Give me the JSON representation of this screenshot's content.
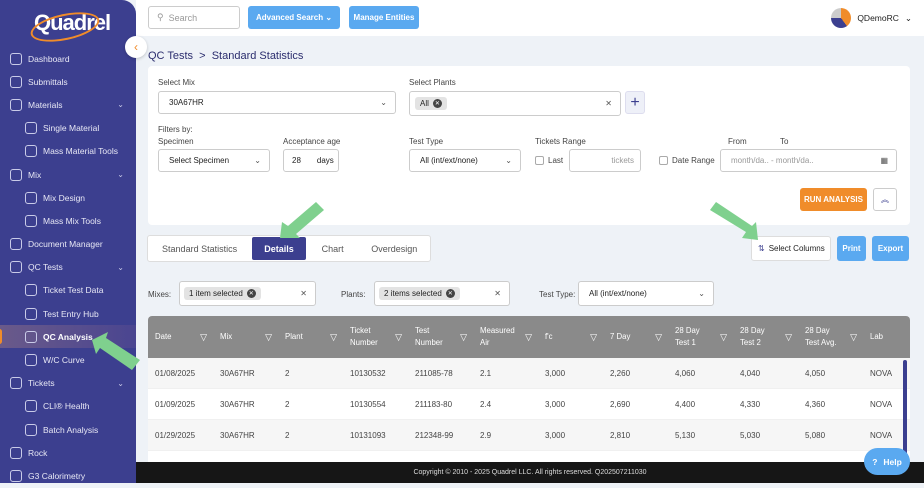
{
  "brand": "Quadrel",
  "sidebar": {
    "items": [
      {
        "label": "Dashboard",
        "sub": false
      },
      {
        "label": "Submittals",
        "sub": false
      },
      {
        "label": "Materials",
        "sub": false,
        "chev": true
      },
      {
        "label": "Single Material",
        "sub": true
      },
      {
        "label": "Mass Material Tools",
        "sub": true
      },
      {
        "label": "Mix",
        "sub": false,
        "chev": true
      },
      {
        "label": "Mix Design",
        "sub": true
      },
      {
        "label": "Mass Mix Tools",
        "sub": true
      },
      {
        "label": "Document Manager",
        "sub": false
      },
      {
        "label": "QC Tests",
        "sub": false,
        "chev": true
      },
      {
        "label": "Ticket Test Data",
        "sub": true
      },
      {
        "label": "Test Entry Hub",
        "sub": true
      },
      {
        "label": "QC Analysis",
        "sub": true,
        "active": true
      },
      {
        "label": "W/C Curve",
        "sub": true
      },
      {
        "label": "Tickets",
        "sub": false,
        "chev": true
      },
      {
        "label": "CLI® Health",
        "sub": true
      },
      {
        "label": "Batch Analysis",
        "sub": true
      },
      {
        "label": "Rock",
        "sub": false
      },
      {
        "label": "G3 Calorimetry",
        "sub": false
      }
    ]
  },
  "topbar": {
    "search_placeholder": "Search",
    "advanced_search": "Advanced Search",
    "manage_entities": "Manage Entities",
    "user": "QDemoRC"
  },
  "breadcrumb": {
    "parent": "QC Tests",
    "sep": ">",
    "current": "Standard Statistics"
  },
  "filters": {
    "select_mix_label": "Select Mix",
    "mix_value": "30A67HR",
    "select_plants_label": "Select Plants",
    "plants_chip": "All",
    "filters_by": "Filters by:",
    "specimen_label": "Specimen",
    "specimen_value": "Select Specimen",
    "acceptance_age_label": "Acceptance age",
    "acceptance_age": "28",
    "days": "days",
    "test_type_label": "Test Type",
    "test_type_value": "All (int/ext/none)",
    "tickets_range_label": "Tickets Range",
    "last_label": "Last",
    "tickets_placeholder": "tickets",
    "date_range_label": "Date Range",
    "from_label": "From",
    "to_label": "To",
    "from_placeholder": "month/da..",
    "to_placeholder": "month/da..",
    "run_analysis": "RUN ANALYSIS"
  },
  "tabs": [
    "Standard Statistics",
    "Details",
    "Chart",
    "Overdesign"
  ],
  "actions": {
    "select_columns": "Select Columns",
    "print": "Print",
    "export": "Export"
  },
  "subfilters": {
    "mixes_label": "Mixes:",
    "mixes_chip": "1 item selected",
    "plants_label": "Plants:",
    "plants_chip": "2 items selected",
    "test_type_label": "Test Type:",
    "test_type_value": "All (int/ext/none)"
  },
  "table": {
    "columns": [
      "Date",
      "Mix",
      "Plant",
      "Ticket Number",
      "Test Number",
      "Measured Air",
      "f'c",
      "7 Day",
      "28 Day Test 1",
      "28 Day Test 2",
      "28 Day Test Avg.",
      "Lab"
    ],
    "rows": [
      [
        "01/08/2025",
        "30A67HR",
        "2",
        "10130532",
        "211085-78",
        "2.1",
        "3,000",
        "2,260",
        "4,060",
        "4,040",
        "4,050",
        "NOVA"
      ],
      [
        "01/09/2025",
        "30A67HR",
        "2",
        "10130554",
        "211183-80",
        "2.4",
        "3,000",
        "2,690",
        "4,400",
        "4,330",
        "4,360",
        "NOVA"
      ],
      [
        "01/29/2025",
        "30A67HR",
        "2",
        "10131093",
        "212348-99",
        "2.9",
        "3,000",
        "2,810",
        "5,130",
        "5,030",
        "5,080",
        "NOVA"
      ]
    ]
  },
  "footer": "Copyright © 2010 - 2025 Quadrel LLC. All rights reserved. Q202507211030",
  "help": "Help"
}
